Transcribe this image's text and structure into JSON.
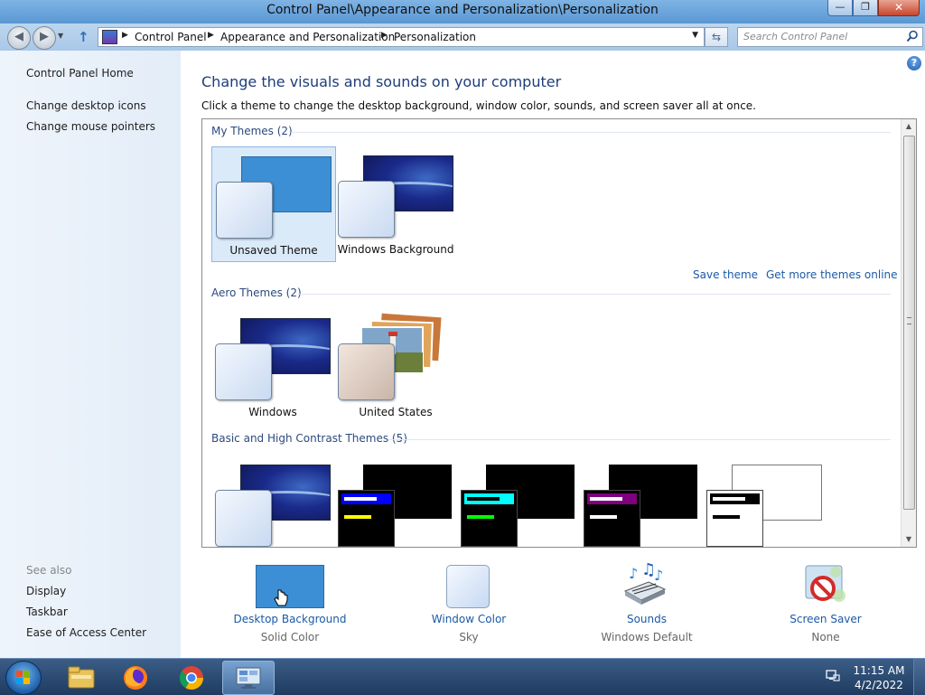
{
  "window": {
    "title": "Control Panel\\Appearance and Personalization\\Personalization",
    "minimize_glyph": "—",
    "maximize_glyph": "❐",
    "close_glyph": "✕"
  },
  "addressbar": {
    "back_glyph": "◀",
    "forward_glyph": "▶",
    "breadcrumbs": [
      "Control Panel",
      "Appearance and Personalization",
      "Personalization"
    ],
    "search_placeholder": "Search Control Panel"
  },
  "leftpane": {
    "home": "Control Panel Home",
    "links": [
      "Change desktop icons",
      "Change mouse pointers"
    ],
    "see_also_label": "See also",
    "see_also": [
      "Display",
      "Taskbar",
      "Ease of Access Center"
    ]
  },
  "main": {
    "heading": "Change the visuals and sounds on your computer",
    "subtitle": "Click a theme to change the desktop background, window color, sounds, and screen saver all at once.",
    "help_glyph": "?"
  },
  "themes": {
    "my_themes_label": "My Themes (2)",
    "my_themes": [
      "Unsaved Theme",
      "Windows Background"
    ],
    "save_theme": "Save theme",
    "get_more": "Get more themes online",
    "aero_label": "Aero Themes (2)",
    "aero": [
      "Windows",
      "United States"
    ],
    "basic_label": "Basic and High Contrast Themes (5)"
  },
  "settings": [
    {
      "label": "Desktop Background",
      "value": "Solid Color"
    },
    {
      "label": "Window Color",
      "value": "Sky"
    },
    {
      "label": "Sounds",
      "value": "Windows Default"
    },
    {
      "label": "Screen Saver",
      "value": "None"
    }
  ],
  "colors": {
    "link": "#1a5aa7",
    "heading": "#1e3d7a",
    "selected_bg": "#dbeaf9",
    "solid_color_bg": "#3c8fd4"
  },
  "taskbar": {
    "time": "11:15 AM",
    "date": "4/2/2022",
    "pinned": [
      "file-explorer-icon",
      "firefox-icon",
      "chrome-icon",
      "control-panel-icon"
    ]
  }
}
